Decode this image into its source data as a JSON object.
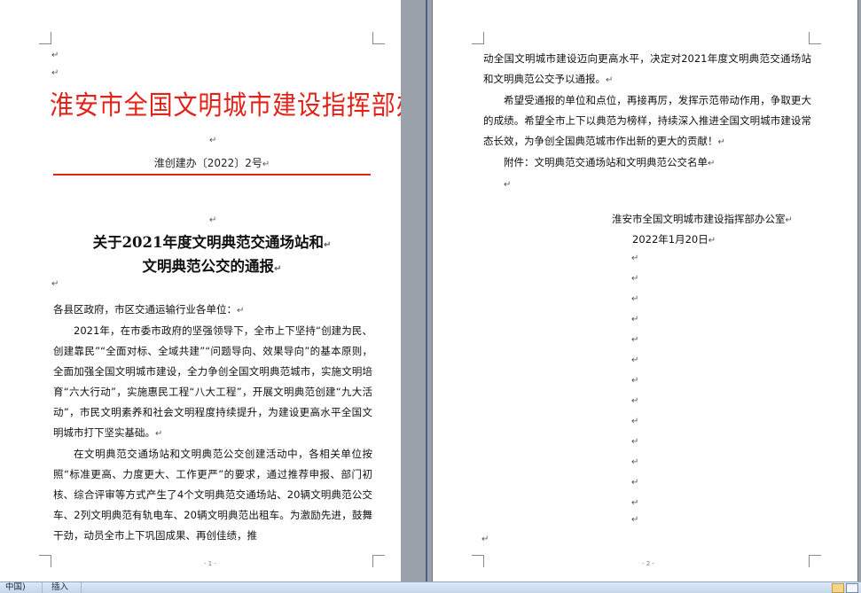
{
  "page1": {
    "org_title": "淮安市全国文明城市建设指挥部办公室",
    "doc_number": "淮创建办〔2022〕2号",
    "notice_title_line1": "关于2021年度文明典范交通场站和",
    "notice_title_line2": "文明典范公交的通报",
    "salutation": "各县区政府，市区交通运输行业各单位：",
    "para1": "2021年，在市委市政府的坚强领导下，全市上下坚持“创建为民、创建靠民”“全面对标、全域共建”“问题导向、效果导向”的基本原则，全面加强全国文明城市建设，全力争创全国文明典范城市，实施文明培育“六大行动”，实施惠民工程“八大工程”，开展文明典范创建“九大活动”，市民文明素养和社会文明程度持续提升，为建设更高水平全国文明城市打下坚实基础。",
    "para2": "在文明典范交通场站和文明典范公交创建活动中，各相关单位按照“标准更高、力度更大、工作更严”的要求，通过推荐申报、部门初核、综合评审等方式产生了4个文明典范交通场站、20辆文明典范公交车、2列文明典范有轨电车、20辆文明典范出租车。为激励先进，鼓舞干劲，动员全市上下巩固成果、再创佳绩，推",
    "page_num": "- 1 -"
  },
  "page2": {
    "para_cont": "动全国文明城市建设迈向更高水平，决定对2021年度文明典范交通场站和文明典范公交予以通报。",
    "para3": "希望受通报的单位和点位，再接再厉，发挥示范带动作用，争取更大的成绩。希望全市上下以典范为榜样，持续深入推进全国文明城市建设常态长效，为争创全国典范城市作出新的更大的贡献！",
    "attachment": "附件：文明典范交通场站和文明典范公交名单",
    "signature_org": "淮安市全国文明城市建设指挥部办公室",
    "signature_date": "2022年1月20日",
    "page_num": "- 2 -"
  },
  "statusbar": {
    "language": "中国)",
    "mode": "插入"
  },
  "marks": {
    "para": "↵"
  },
  "colors": {
    "red": "#e2231a",
    "workspace": "#9aa1ab"
  }
}
